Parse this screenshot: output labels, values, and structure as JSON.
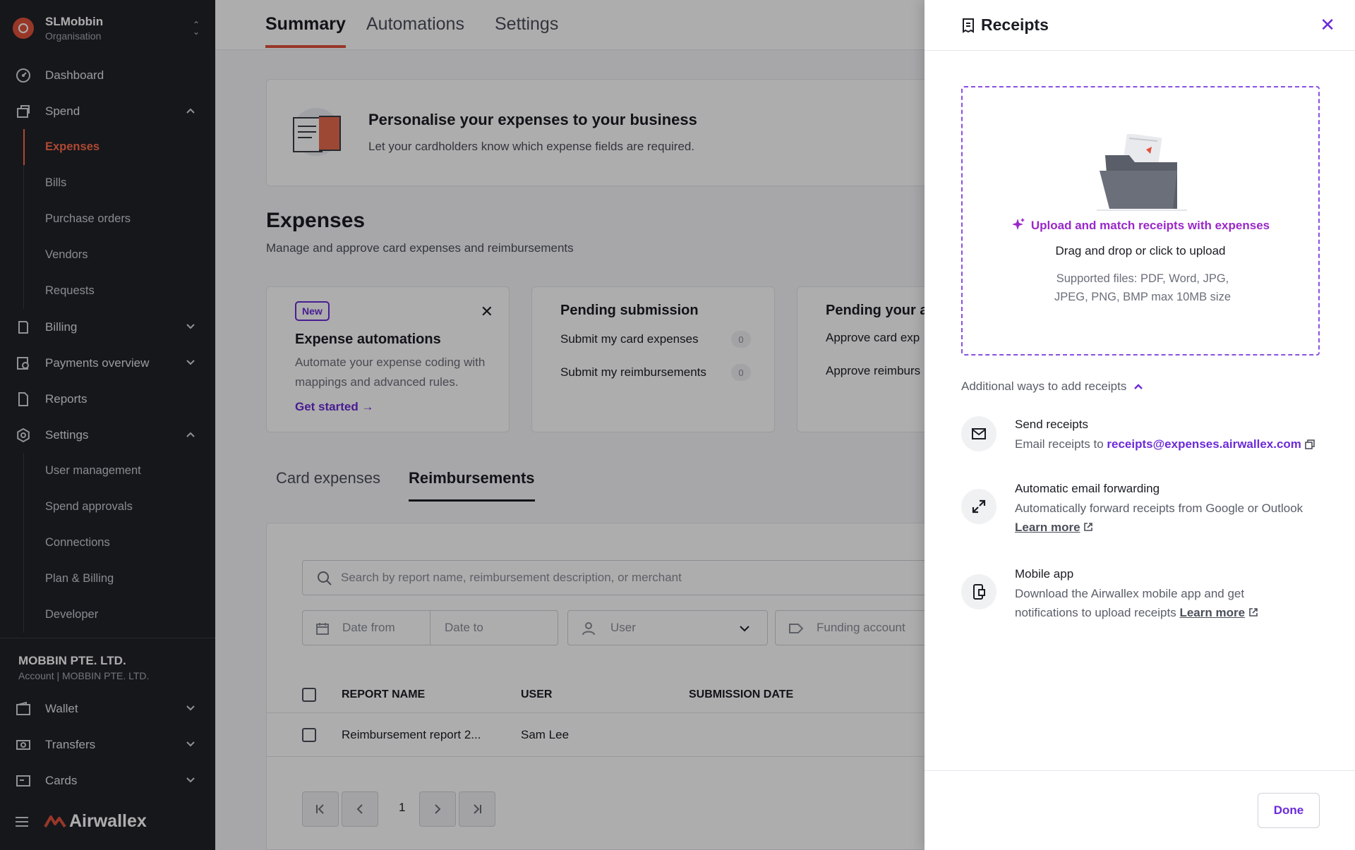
{
  "org": {
    "name": "SLMobbin",
    "subtitle": "Organisation"
  },
  "nav": {
    "dashboard": "Dashboard",
    "spend": "Spend",
    "spend_items": [
      "Expenses",
      "Bills",
      "Purchase orders",
      "Vendors",
      "Requests"
    ],
    "billing": "Billing",
    "payments_overview": "Payments overview",
    "reports": "Reports",
    "settings": "Settings",
    "settings_items": [
      "User management",
      "Spend approvals",
      "Connections",
      "Plan & Billing",
      "Developer"
    ]
  },
  "account": {
    "name": "MOBBIN PTE. LTD.",
    "subtitle": "Account | MOBBIN PTE. LTD."
  },
  "nav2": {
    "wallet": "Wallet",
    "transfers": "Transfers",
    "cards": "Cards"
  },
  "brand": {
    "name": "Airwallex",
    "color": "#e0523b"
  },
  "top_tabs": [
    "Summary",
    "Automations",
    "Settings"
  ],
  "promo": {
    "title": "Personalise your expenses to your business",
    "description": "Let your cardholders know which expense fields are required."
  },
  "expenses": {
    "title": "Expenses",
    "description": "Manage and approve card expenses and reimbursements"
  },
  "cards": {
    "automations": {
      "badge": "New",
      "title": "Expense automations",
      "text": "Automate your expense coding with mappings and advanced rules.",
      "link": "Get started →"
    },
    "pending_submission": {
      "title": "Pending submission",
      "rows": [
        {
          "label": "Submit my card expenses",
          "count": "0"
        },
        {
          "label": "Submit my reimbursements",
          "count": "0"
        }
      ]
    },
    "pending_approval": {
      "title": "Pending your a",
      "rows": [
        {
          "label": "Approve card exp"
        },
        {
          "label": "Approve reimburs"
        }
      ]
    }
  },
  "sub_tabs": [
    "Card expenses",
    "Reimbursements"
  ],
  "table": {
    "search_placeholder": "Search by report name, reimbursement description, or merchant",
    "filters": {
      "date_from": "Date from",
      "date_to": "Date to",
      "user": "User",
      "funding": "Funding account"
    },
    "columns": [
      "REPORT NAME",
      "USER",
      "SUBMISSION DATE"
    ],
    "rows": [
      {
        "report_name": "Reimbursement report 2...",
        "user": "Sam Lee"
      }
    ],
    "page": "1"
  },
  "drawer": {
    "title": "Receipts",
    "upload_cta": "Upload and match receipts with expenses",
    "drag_hint": "Drag and drop or click to upload",
    "supported": "Supported files: PDF, Word, JPG, JPEG, PNG, BMP max 10MB size",
    "additional": "Additional ways to add receipts",
    "ways": {
      "send": {
        "title": "Send receipts",
        "prefix": "Email receipts to",
        "email": "receipts@expenses.airwallex.com"
      },
      "forward": {
        "title": "Automatic email forwarding",
        "text": "Automatically forward receipts from Google or Outlook",
        "link": "Learn more"
      },
      "mobile": {
        "title": "Mobile app",
        "text": "Download the Airwallex mobile app and get notifications to upload receipts",
        "link": "Learn more"
      }
    },
    "done": "Done",
    "accent": "#6c2bd9"
  }
}
